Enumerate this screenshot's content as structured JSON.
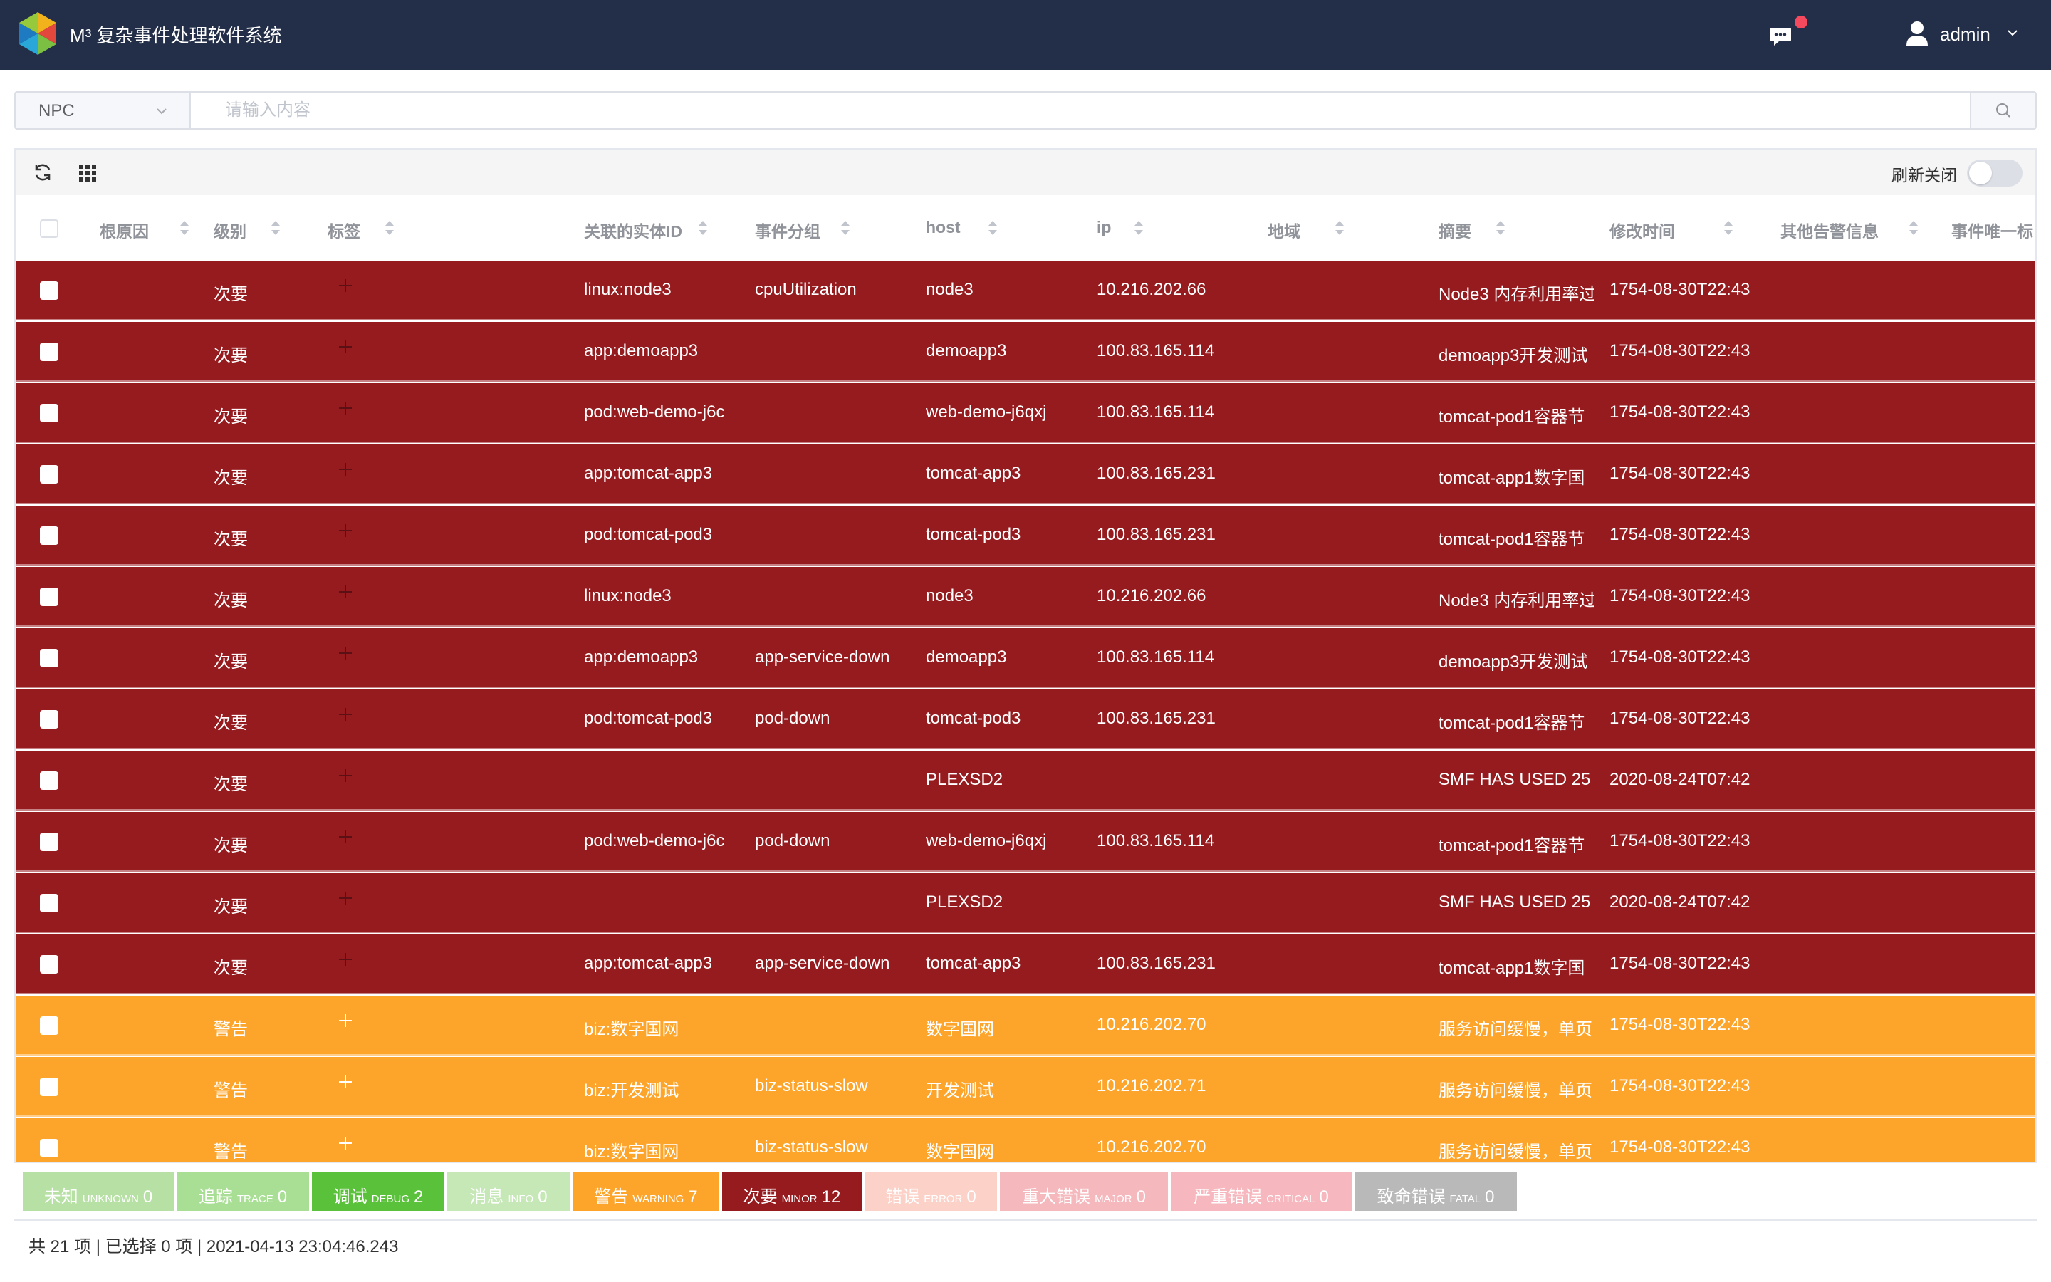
{
  "header": {
    "title": "M³ 复杂事件处理软件系统",
    "user": "admin"
  },
  "search": {
    "selected": "NPC",
    "placeholder": "请输入内容"
  },
  "toolbar": {
    "refresh_label": "刷新关闭",
    "refresh_on": false
  },
  "columns": [
    "根原因",
    "级别",
    "标签",
    "关联的实体ID",
    "事件分组",
    "host",
    "ip",
    "地域",
    "摘要",
    "修改时间",
    "其他告警信息",
    "事件唯一标"
  ],
  "rows": [
    {
      "level": "次要",
      "severity": "minor",
      "entity": "linux:node3",
      "group": "cpuUtilization",
      "host": "node3",
      "ip": "10.216.202.66",
      "summary": "Node3 内存利用率过",
      "time": "1754-08-30T22:43"
    },
    {
      "level": "次要",
      "severity": "minor",
      "entity": "app:demoapp3",
      "group": "",
      "host": "demoapp3",
      "ip": "100.83.165.114",
      "summary": "demoapp3开发测试",
      "time": "1754-08-30T22:43"
    },
    {
      "level": "次要",
      "severity": "minor",
      "entity": "pod:web-demo-j6c",
      "group": "",
      "host": "web-demo-j6qxj",
      "ip": "100.83.165.114",
      "summary": "tomcat-pod1容器节",
      "time": "1754-08-30T22:43"
    },
    {
      "level": "次要",
      "severity": "minor",
      "entity": "app:tomcat-app3",
      "group": "",
      "host": "tomcat-app3",
      "ip": "100.83.165.231",
      "summary": "tomcat-app1数字国",
      "time": "1754-08-30T22:43"
    },
    {
      "level": "次要",
      "severity": "minor",
      "entity": "pod:tomcat-pod3",
      "group": "",
      "host": "tomcat-pod3",
      "ip": "100.83.165.231",
      "summary": "tomcat-pod1容器节",
      "time": "1754-08-30T22:43"
    },
    {
      "level": "次要",
      "severity": "minor",
      "entity": "linux:node3",
      "group": "",
      "host": "node3",
      "ip": "10.216.202.66",
      "summary": "Node3 内存利用率过",
      "time": "1754-08-30T22:43"
    },
    {
      "level": "次要",
      "severity": "minor",
      "entity": "app:demoapp3",
      "group": "app-service-down",
      "host": "demoapp3",
      "ip": "100.83.165.114",
      "summary": "demoapp3开发测试",
      "time": "1754-08-30T22:43"
    },
    {
      "level": "次要",
      "severity": "minor",
      "entity": "pod:tomcat-pod3",
      "group": "pod-down",
      "host": "tomcat-pod3",
      "ip": "100.83.165.231",
      "summary": "tomcat-pod1容器节",
      "time": "1754-08-30T22:43"
    },
    {
      "level": "次要",
      "severity": "minor",
      "entity": "",
      "group": "",
      "host": "PLEXSD2",
      "ip": "",
      "summary": "SMF HAS USED 25",
      "time": "2020-08-24T07:42"
    },
    {
      "level": "次要",
      "severity": "minor",
      "entity": "pod:web-demo-j6c",
      "group": "pod-down",
      "host": "web-demo-j6qxj",
      "ip": "100.83.165.114",
      "summary": "tomcat-pod1容器节",
      "time": "1754-08-30T22:43"
    },
    {
      "level": "次要",
      "severity": "minor",
      "entity": "",
      "group": "",
      "host": "PLEXSD2",
      "ip": "",
      "summary": "SMF HAS USED 25",
      "time": "2020-08-24T07:42"
    },
    {
      "level": "次要",
      "severity": "minor",
      "entity": "app:tomcat-app3",
      "group": "app-service-down",
      "host": "tomcat-app3",
      "ip": "100.83.165.231",
      "summary": "tomcat-app1数字国",
      "time": "1754-08-30T22:43"
    },
    {
      "level": "警告",
      "severity": "warning",
      "entity": "biz:数字国网",
      "group": "",
      "host": "数字国网",
      "ip": "10.216.202.70",
      "summary": "服务访问缓慢，单页",
      "time": "1754-08-30T22:43"
    },
    {
      "level": "警告",
      "severity": "warning",
      "entity": "biz:开发测试",
      "group": "biz-status-slow",
      "host": "开发测试",
      "ip": "10.216.202.71",
      "summary": "服务访问缓慢，单页",
      "time": "1754-08-30T22:43"
    },
    {
      "level": "警告",
      "severity": "warning",
      "entity": "biz:数字国网",
      "group": "biz-status-slow",
      "host": "数字国网",
      "ip": "10.216.202.70",
      "summary": "服务访问缓慢，单页",
      "time": "1754-08-30T22:43"
    }
  ],
  "legend": [
    {
      "cn": "未知",
      "en": "UNKNOWN",
      "count": "0",
      "color": "#b7e0a5"
    },
    {
      "cn": "追踪",
      "en": "TRACE",
      "count": "0",
      "color": "#a9df95"
    },
    {
      "cn": "调试",
      "en": "DEBUG",
      "count": "2",
      "color": "#5ac13a"
    },
    {
      "cn": "消息",
      "en": "INFO",
      "count": "0",
      "color": "#c5e8b6"
    },
    {
      "cn": "警告",
      "en": "WARNING",
      "count": "7",
      "color": "#fda52b"
    },
    {
      "cn": "次要",
      "en": "MINOR",
      "count": "12",
      "color": "#951b1f"
    },
    {
      "cn": "错误",
      "en": "ERROR",
      "count": "0",
      "color": "#fbd1c8"
    },
    {
      "cn": "重大错误",
      "en": "MAJOR",
      "count": "0",
      "color": "#f5b8bd"
    },
    {
      "cn": "严重错误",
      "en": "CRITICAL",
      "count": "0",
      "color": "#f6b7be"
    },
    {
      "cn": "致命错误",
      "en": "FATAL",
      "count": "0",
      "color": "#b9b9b9"
    }
  ],
  "footer": {
    "text": "共 21 项 | 已选择 0 项 | 2021-04-13 23:04:46.243"
  }
}
